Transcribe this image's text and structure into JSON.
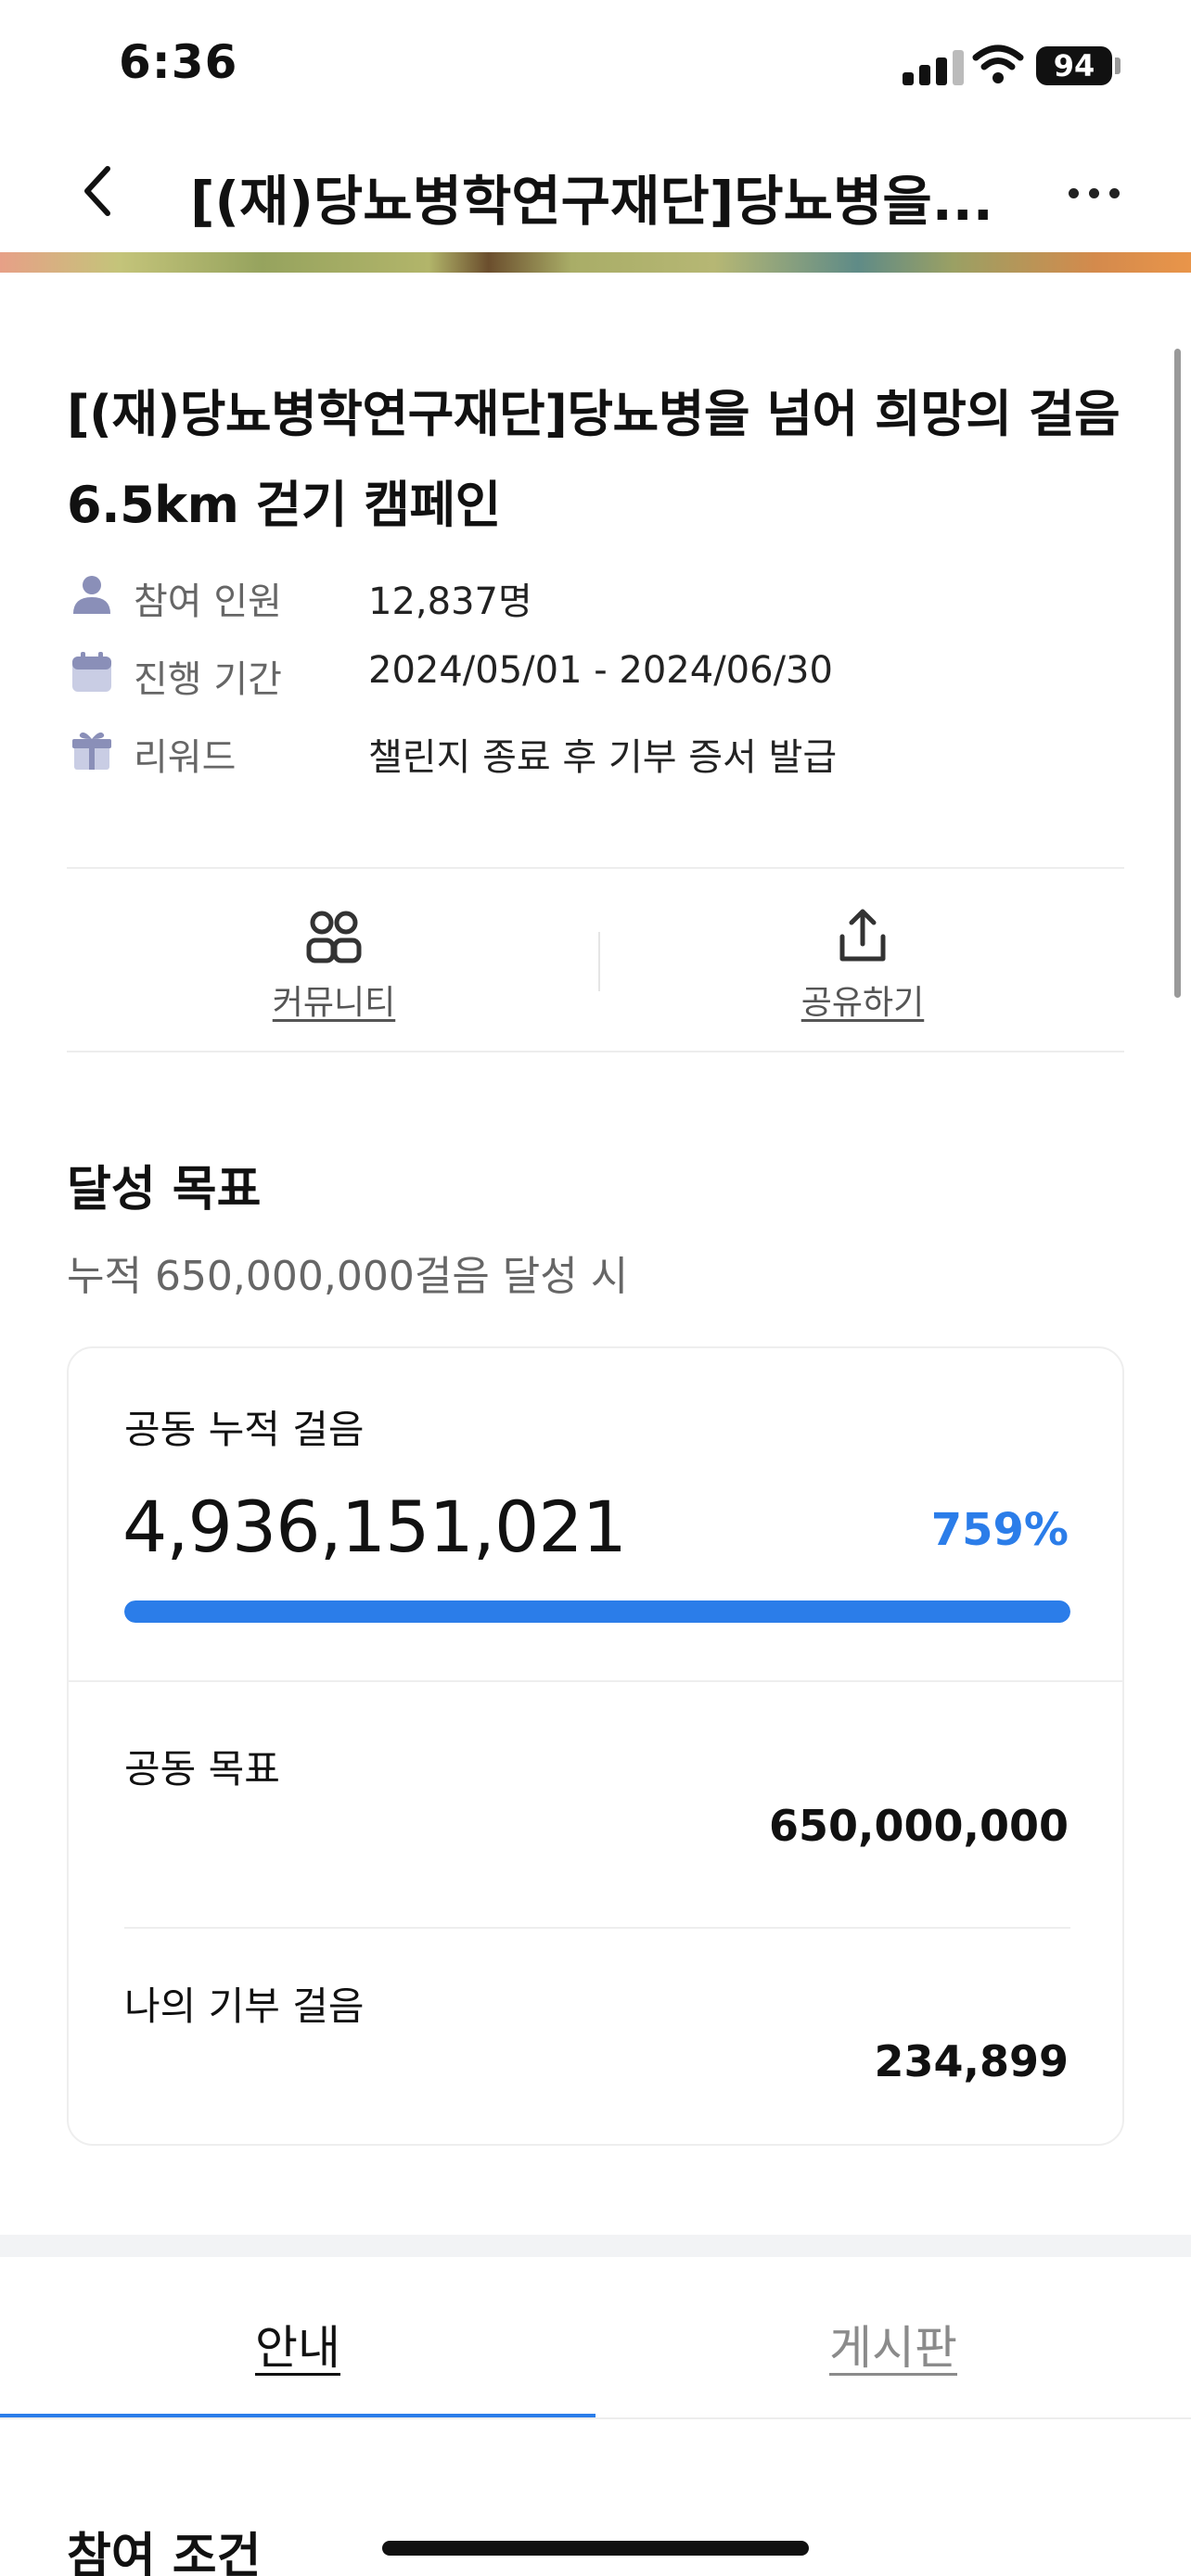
{
  "status_bar": {
    "time": "6:36",
    "battery": "94"
  },
  "nav": {
    "title": "[(재)당뇨병학연구재단]당뇨병을..."
  },
  "campaign": {
    "title": "[(재)당뇨병학연구재단]당뇨병을 넘어 희망의 걸음 6.5km 걷기 캠페인",
    "info": [
      {
        "icon": "person-icon",
        "label": "참여 인원",
        "value": "12,837명"
      },
      {
        "icon": "calendar-icon",
        "label": "진행 기간",
        "value": "2024/05/01 - 2024/06/30"
      },
      {
        "icon": "gift-icon",
        "label": "리워드",
        "value": "챌린지 종료 후 기부 증서 발급"
      }
    ]
  },
  "actions": [
    {
      "label": "커뮤니티",
      "icon": "community-icon"
    },
    {
      "label": "공유하기",
      "icon": "share-icon"
    }
  ],
  "goal": {
    "title": "달성 목표",
    "subtitle": "누적 650,000,000걸음 달성 시",
    "cumulative_label": "공동 누적 걸음",
    "cumulative_steps": "4,936,151,021",
    "percent": "759%",
    "progress_fraction": 1.0,
    "target_label": "공동 목표",
    "target_value": "650,000,000",
    "my_label": "나의 기부 걸음",
    "my_value": "234,899"
  },
  "tabs": [
    {
      "label": "안내",
      "active": true
    },
    {
      "label": "게시판",
      "active": false
    }
  ],
  "next_section": {
    "title": "참여 조건"
  },
  "colors": {
    "accent": "#2b7de9",
    "icon": "#8a8fb8"
  }
}
